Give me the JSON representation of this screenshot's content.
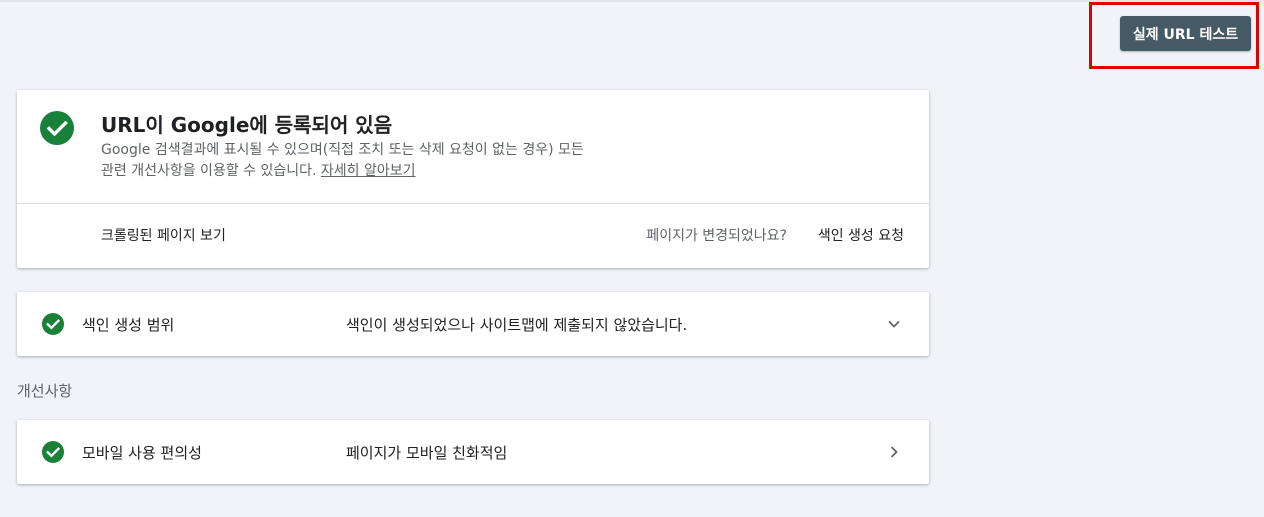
{
  "toolbar": {
    "live_test_label": "실제 URL 테스트"
  },
  "status_card": {
    "title": "URL이 Google에 등록되어 있음",
    "description_line1": "Google 검색결과에 표시될 수 있으며(직접 조치 또는 삭제 요청이 없는 경우) 모든",
    "description_line2": "관련 개선사항을 이용할 수 있습니다.",
    "learn_more_label": "자세히 알아보기",
    "view_crawled_label": "크롤링된 페이지 보기",
    "page_changed_label": "페이지가 변경되었나요?",
    "request_indexing_label": "색인 생성 요청"
  },
  "coverage": {
    "label": "색인 생성 범위",
    "value": "색인이 생성되었으나 사이트맵에 제출되지 않았습니다."
  },
  "enhancements": {
    "heading": "개선사항",
    "mobile": {
      "label": "모바일 사용 편의성",
      "value": "페이지가 모바일 친화적임"
    }
  },
  "colors": {
    "success_green": "#188038",
    "button_bg": "#455a64",
    "highlight_red": "#e00000",
    "page_bg": "#f1f3f9"
  },
  "icons": {
    "status": "check-circle-icon",
    "coverage_toggle": "chevron-down-icon",
    "mobile_toggle": "chevron-right-icon"
  }
}
